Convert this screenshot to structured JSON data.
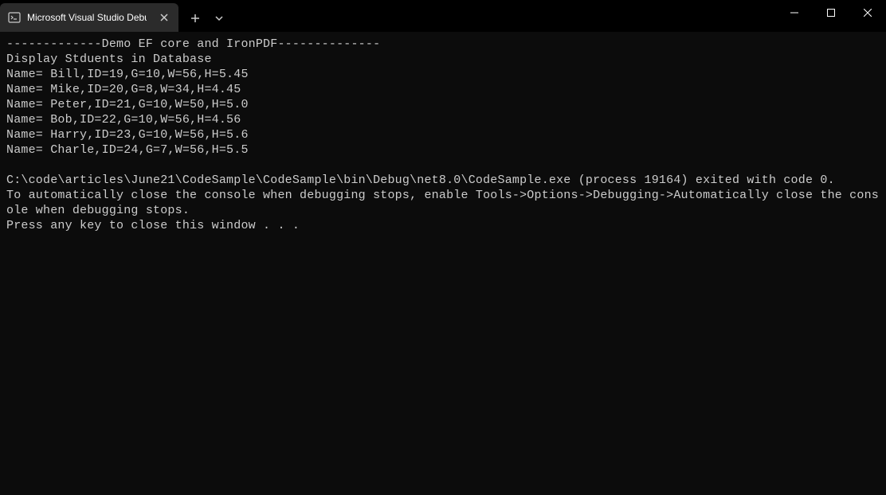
{
  "titlebar": {
    "tab_title": "Microsoft Visual Studio Debug"
  },
  "console": {
    "lines": [
      "-------------Demo EF core and IronPDF--------------",
      "Display Stduents in Database",
      "Name= Bill,ID=19,G=10,W=56,H=5.45",
      "Name= Mike,ID=20,G=8,W=34,H=4.45",
      "Name= Peter,ID=21,G=10,W=50,H=5.0",
      "Name= Bob,ID=22,G=10,W=56,H=4.56",
      "Name= Harry,ID=23,G=10,W=56,H=5.6",
      "Name= Charle,ID=24,G=7,W=56,H=5.5",
      "",
      "C:\\code\\articles\\June21\\CodeSample\\CodeSample\\bin\\Debug\\net8.0\\CodeSample.exe (process 19164) exited with code 0.",
      "To automatically close the console when debugging stops, enable Tools->Options->Debugging->Automatically close the console when debugging stops.",
      "Press any key to close this window . . ."
    ]
  }
}
